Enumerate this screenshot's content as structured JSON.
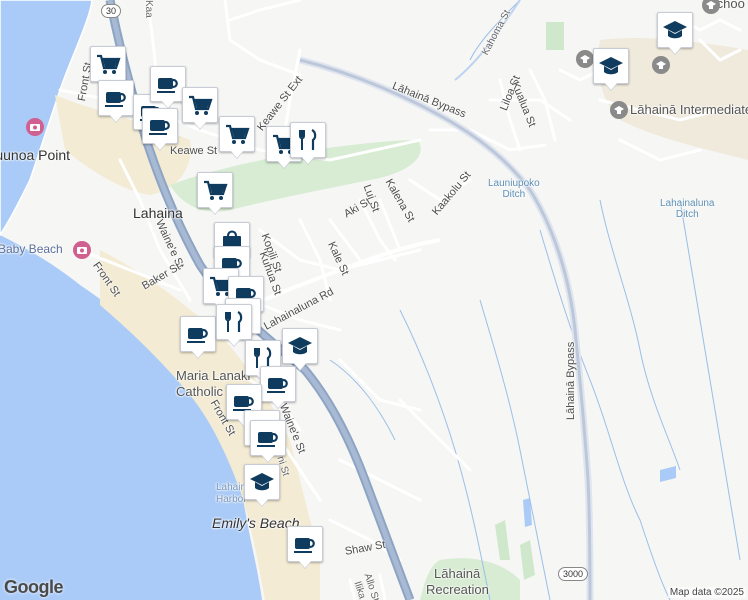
{
  "map": {
    "labels": {
      "lahaina": "Lahaina",
      "front_st_n": "Front St",
      "front_st_w": "Front St",
      "front_st_s": "Front St",
      "waineae_n": "Waine'e St",
      "waineae_s": "Waine'e St",
      "baker_st": "Baker St",
      "kopili_st": "Kopili St",
      "kuhua_st": "Kuhua St",
      "kale_st": "Kale St",
      "aki_st": "Aki St",
      "lui_st": "Lui St",
      "kalena_st": "Kalena St",
      "kaakolu_st": "Kaakolu St",
      "lahainaluna_rd": "Lahainaluna Rd",
      "keawe_st": "Keawe St",
      "keawe_st_ext": "Keawe St Ext",
      "lahaina_bypass_n": "Lāhainā Bypass",
      "lahaina_bypass_s": "Lāhainā Bypass",
      "liloa_st": "Liloa St",
      "kualua_st": "Kualua St",
      "kahoma_st": "Kahoma St",
      "launiupoko_ditch": "Launiupoko\nDitch",
      "lahainaluna_ditch": "Lahainaluna\nDitch",
      "intermediate_school": "Lāhainā Intermediate School",
      "school_top": "Schoo",
      "uunoa_point": "Puunoa Point",
      "baby_beach": "Baby Beach",
      "maria_lanakila": "Maria Lanaki",
      "catholic": "Catholic",
      "lahaina_harbor": "Lahaina Harbor",
      "emilys_beach": "Emily's Beach",
      "shaw_st": "Shaw St",
      "recreation_1": "Lāhainā",
      "recreation_2": "Recreation",
      "allo_st": "Allo St",
      "ilika_st": "Ilika",
      "ni_st": "ni St",
      "ka_top": "Kaa",
      "route_30": "30",
      "route_3000": "3000"
    },
    "attribution": "Map data ©2025",
    "logo": "Google",
    "icon_colors": {
      "pin_icon": "#0e3b5e",
      "poi_pink": "#d0608f",
      "poi_gray": "#8a8a8a"
    },
    "pins": [
      {
        "icon": "shopping-cart-icon"
      },
      {
        "icon": "coffee-icon"
      },
      {
        "icon": "coffee-icon"
      },
      {
        "icon": "coffee-icon"
      },
      {
        "icon": "shopping-cart-icon"
      },
      {
        "icon": "coffee-icon"
      },
      {
        "icon": "shopping-cart-icon"
      },
      {
        "icon": "shopping-cart-icon"
      },
      {
        "icon": "restaurant-icon"
      },
      {
        "icon": "shopping-cart-icon"
      },
      {
        "icon": "shopping-bag-icon"
      },
      {
        "icon": "coffee-icon"
      },
      {
        "icon": "shopping-cart-icon"
      },
      {
        "icon": "coffee-icon"
      },
      {
        "icon": "restaurant-icon"
      },
      {
        "icon": "coffee-icon"
      },
      {
        "icon": "restaurant-icon"
      },
      {
        "icon": "school-icon"
      },
      {
        "icon": "restaurant-icon"
      },
      {
        "icon": "coffee-icon"
      },
      {
        "icon": "coffee-icon"
      },
      {
        "icon": "coffee-icon"
      },
      {
        "icon": "coffee-icon"
      },
      {
        "icon": "school-icon"
      },
      {
        "icon": "coffee-icon"
      },
      {
        "icon": "school-icon"
      },
      {
        "icon": "school-icon"
      }
    ]
  }
}
